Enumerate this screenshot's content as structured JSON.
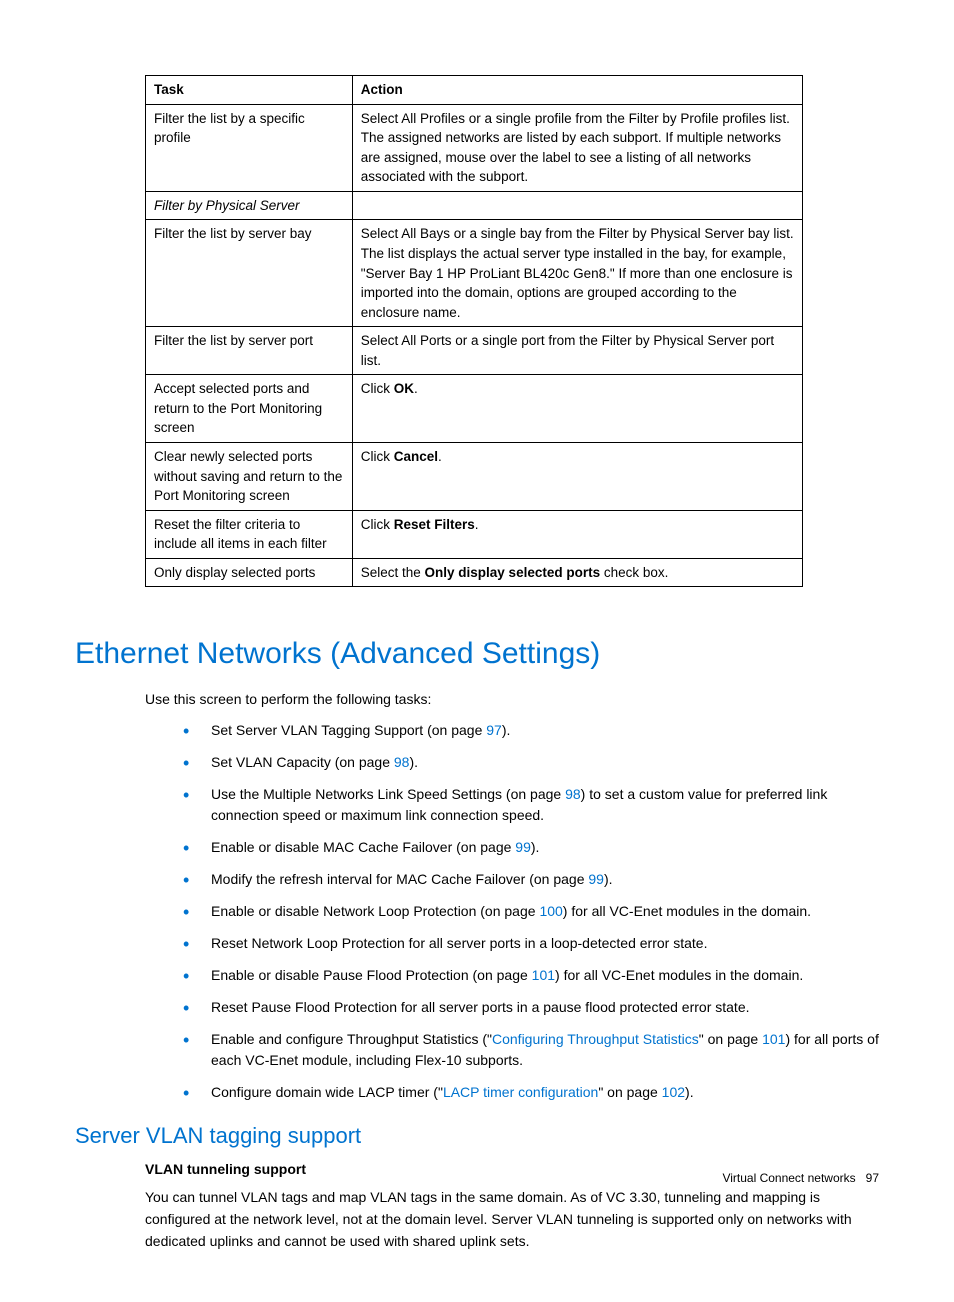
{
  "table": {
    "headers": {
      "task": "Task",
      "action": "Action"
    },
    "rows": [
      {
        "task": "Filter the list by a specific profile",
        "action": "Select All Profiles or a single profile from the Filter by Profile profiles list. The assigned networks are listed by each subport. If multiple networks are assigned, mouse over the label to see a listing of all networks associated with the subport."
      },
      {
        "task_italic": "Filter by Physical Server",
        "action": ""
      },
      {
        "task": "Filter the list by server bay",
        "action": "Select All Bays or a single bay from the Filter by Physical Server bay list. The list displays the actual server type installed in the bay, for example, \"Server Bay 1 HP ProLiant BL420c Gen8.\" If more than one enclosure is imported into the domain, options are grouped according to the enclosure name."
      },
      {
        "task": "Filter the list by server port",
        "action": "Select All Ports or a single port from the Filter by Physical Server port list."
      },
      {
        "task": "Accept selected ports and return to the Port Monitoring screen",
        "action_pre": "Click ",
        "action_bold": "OK",
        "action_post": "."
      },
      {
        "task": "Clear newly selected ports without saving and return to the Port Monitoring screen",
        "action_pre": "Click ",
        "action_bold": "Cancel",
        "action_post": "."
      },
      {
        "task": "Reset the filter criteria to include all items in each filter",
        "action_pre": "Click ",
        "action_bold": "Reset Filters",
        "action_post": "."
      },
      {
        "task": "Only display selected ports",
        "action_pre": "Select the ",
        "action_bold": "Only display selected ports",
        "action_post": " check box."
      }
    ]
  },
  "heading1": "Ethernet Networks (Advanced Settings)",
  "intro": "Use this screen to perform the following tasks:",
  "bullets": {
    "b1_pre": "Set Server VLAN Tagging Support (on page ",
    "b1_link": "97",
    "b1_post": ").",
    "b2_pre": "Set VLAN Capacity (on page ",
    "b2_link": "98",
    "b2_post": ").",
    "b3_pre": "Use the Multiple Networks Link Speed Settings (on page ",
    "b3_link": "98",
    "b3_post": ") to set a custom value for preferred link connection speed or maximum link connection speed.",
    "b4_pre": "Enable or disable MAC Cache Failover (on page ",
    "b4_link": "99",
    "b4_post": ").",
    "b5_pre": "Modify the refresh interval for MAC Cache Failover (on page ",
    "b5_link": "99",
    "b5_post": ").",
    "b6_pre": "Enable or disable Network Loop Protection (on page ",
    "b6_link": "100",
    "b6_post": ") for all VC-Enet modules in the domain.",
    "b7": "Reset Network Loop Protection for all server ports in a loop-detected error state.",
    "b8_pre": "Enable or disable Pause Flood Protection (on page ",
    "b8_link": "101",
    "b8_post": ") for all VC-Enet modules in the domain.",
    "b9": "Reset Pause Flood Protection for all server ports in a pause flood protected error state.",
    "b10_pre": "Enable and configure Throughput Statistics (\"",
    "b10_link1": "Configuring Throughput Statistics",
    "b10_mid": "\" on page ",
    "b10_link2": "101",
    "b10_post": ") for all ports of each VC-Enet module, including Flex-10 subports.",
    "b11_pre": "Configure domain wide LACP timer (\"",
    "b11_link1": "LACP timer configuration",
    "b11_mid": "\" on page ",
    "b11_link2": "102",
    "b11_post": ")."
  },
  "heading2": "Server VLAN tagging support",
  "subheading": "VLAN tunneling support",
  "body_para": "You can tunnel VLAN tags and map VLAN tags in the same domain. As of VC 3.30, tunneling and mapping is configured at the network level, not at the domain level. Server VLAN tunneling is supported only on networks with dedicated uplinks and cannot be used with shared uplink sets.",
  "footer": {
    "section": "Virtual Connect networks",
    "page": "97"
  }
}
